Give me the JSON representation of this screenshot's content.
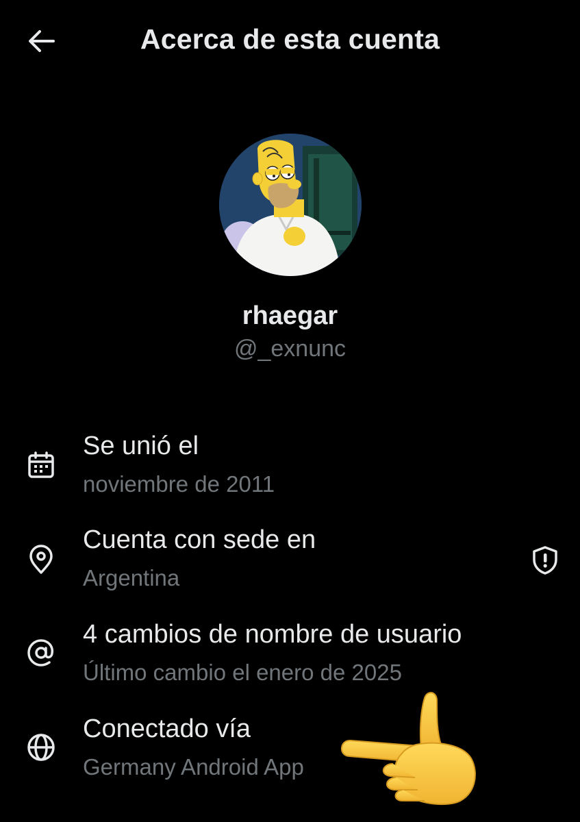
{
  "header": {
    "title": "Acerca de esta cuenta",
    "back_icon": "arrow-left-icon"
  },
  "profile": {
    "display_name": "rhaegar",
    "handle": "@_exnunc"
  },
  "info": [
    {
      "icon": "calendar-icon",
      "title": "Se unió el",
      "subtitle": "noviembre de 2011"
    },
    {
      "icon": "location-pin-icon",
      "title": "Cuenta con sede en",
      "subtitle": "Argentina",
      "trailing_icon": "shield-alert-icon"
    },
    {
      "icon": "at-sign-icon",
      "title": "4 cambios de nombre de usuario",
      "subtitle": "Último cambio el enero de 2025"
    },
    {
      "icon": "globe-icon",
      "title": "Conectado vía",
      "subtitle": "Germany Android App"
    }
  ],
  "colors": {
    "background": "#000000",
    "text_primary": "#e7e9ea",
    "text_secondary": "#71767b",
    "hand_emoji": "#f7c94a"
  }
}
